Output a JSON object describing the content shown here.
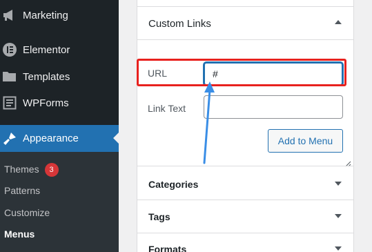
{
  "sidebar": {
    "items": [
      {
        "label": "Marketing",
        "icon": "megaphone-icon"
      },
      {
        "label": "Elementor",
        "icon": "elementor-icon"
      },
      {
        "label": "Templates",
        "icon": "folder-icon"
      },
      {
        "label": "WPForms",
        "icon": "wpforms-icon"
      },
      {
        "label": "Appearance",
        "icon": "paintbrush-icon",
        "active": true
      }
    ],
    "submenu": {
      "themes": "Themes",
      "themes_badge": "3",
      "patterns": "Patterns",
      "customize": "Customize",
      "menus": "Menus"
    },
    "active_color": "#2271b1"
  },
  "panel": {
    "custom_links": {
      "title": "Custom Links",
      "url_label": "URL",
      "url_value": "#",
      "link_text_label": "Link Text",
      "link_text_value": "",
      "add_button": "Add to Menu"
    },
    "sections": {
      "categories": "Categories",
      "tags": "Tags",
      "formats": "Formats"
    }
  },
  "annotation": {
    "highlight_color": "#e8211e",
    "arrow_color": "#3a8ee6"
  }
}
